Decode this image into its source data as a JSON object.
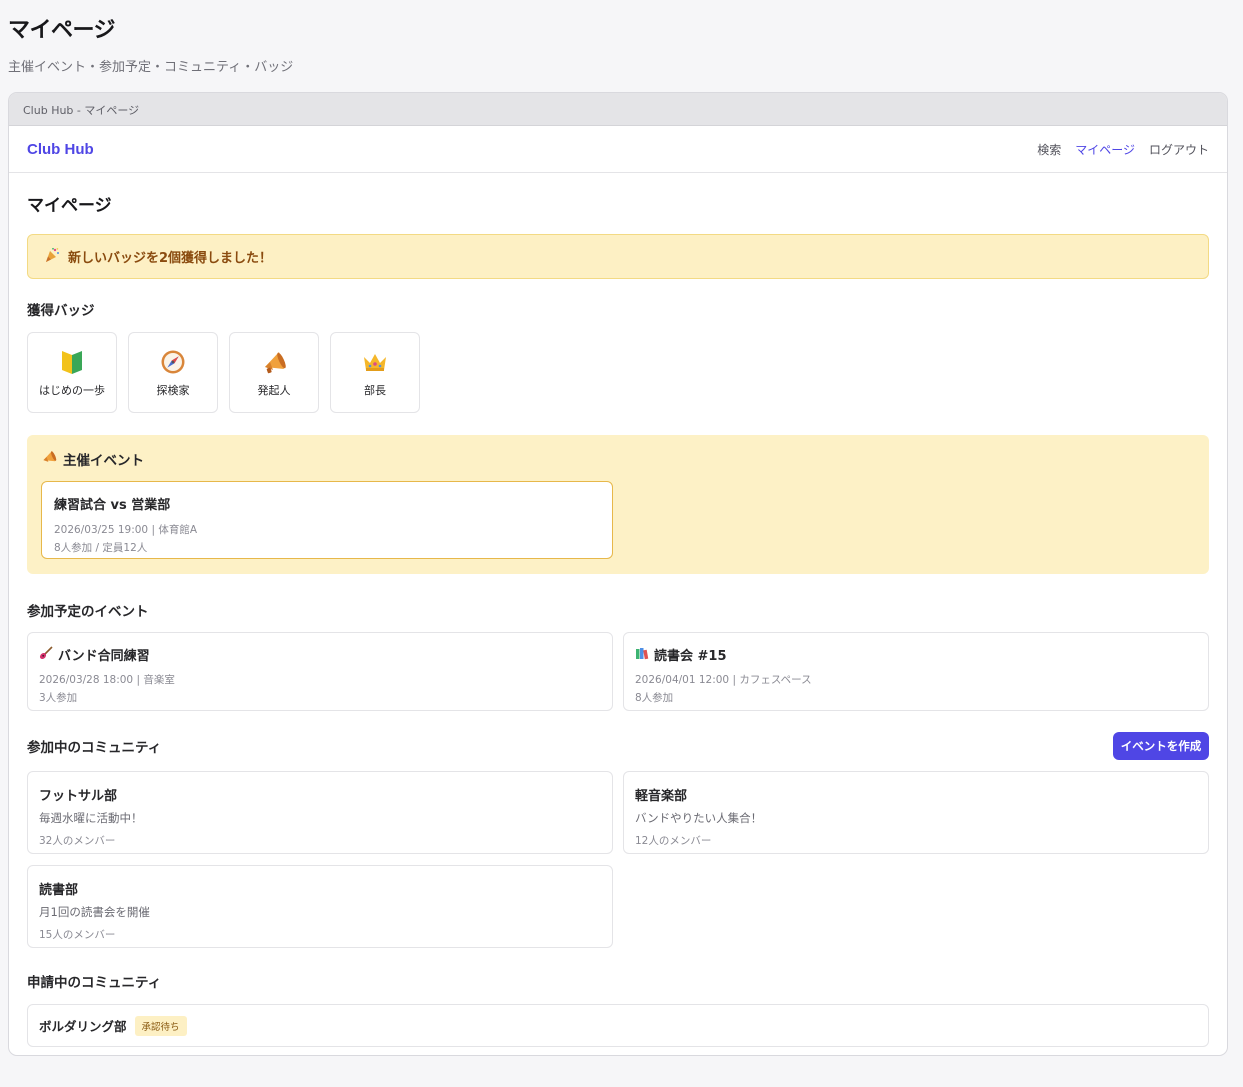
{
  "page": {
    "title": "マイページ",
    "subtitle": "主催イベント・参加予定・コミュニティ・バッジ"
  },
  "window": {
    "title": "Club Hub - マイページ"
  },
  "nav": {
    "brand": "Club Hub",
    "links": [
      {
        "label": "検索",
        "active": false
      },
      {
        "label": "マイページ",
        "active": true
      },
      {
        "label": "ログアウト",
        "active": false
      }
    ]
  },
  "main": {
    "title": "マイページ",
    "alert": {
      "icon": "party-popper-icon",
      "text": "新しいバッジを2個獲得しました！"
    }
  },
  "badges": {
    "title": "獲得バッジ",
    "items": [
      {
        "icon": "beginner-mark-icon",
        "label": "はじめの一歩"
      },
      {
        "icon": "compass-icon",
        "label": "探検家"
      },
      {
        "icon": "megaphone-icon",
        "label": "発起人"
      },
      {
        "icon": "crown-icon",
        "label": "部長"
      }
    ]
  },
  "hosted": {
    "icon": "megaphone-icon",
    "title": "主催イベント",
    "events": [
      {
        "title": "練習試合 vs 営業部",
        "meta": "2026/03/25 19:00 | 体育館A",
        "count": "8人参加 / 定員12人"
      }
    ]
  },
  "upcoming": {
    "title": "参加予定のイベント",
    "events": [
      {
        "icon": "guitar-icon",
        "title": "バンド合同練習",
        "meta": "2026/03/28 18:00 | 音楽室",
        "count": "3人参加"
      },
      {
        "icon": "books-icon",
        "title": "読書会 #15",
        "meta": "2026/04/01 12:00 | カフェスペース",
        "count": "8人参加"
      }
    ]
  },
  "communities": {
    "title": "参加中のコミュニティ",
    "create_button": "イベントを作成",
    "items": [
      {
        "name": "フットサル部",
        "desc": "毎週水曜に活動中！",
        "members": "32人のメンバー"
      },
      {
        "name": "軽音楽部",
        "desc": "バンドやりたい人集合！",
        "members": "12人のメンバー"
      },
      {
        "name": "読書部",
        "desc": "月1回の読書会を開催",
        "members": "15人のメンバー"
      }
    ]
  },
  "pending": {
    "title": "申請中のコミュニティ",
    "items": [
      {
        "name": "ボルダリング部",
        "status": "承認待ち"
      }
    ]
  },
  "colors": {
    "accent": "#4f46e5",
    "alert_bg": "#fdf0c4",
    "hosted_bg": "#fdf1c6",
    "hosted_card_border": "#e7b84a"
  }
}
